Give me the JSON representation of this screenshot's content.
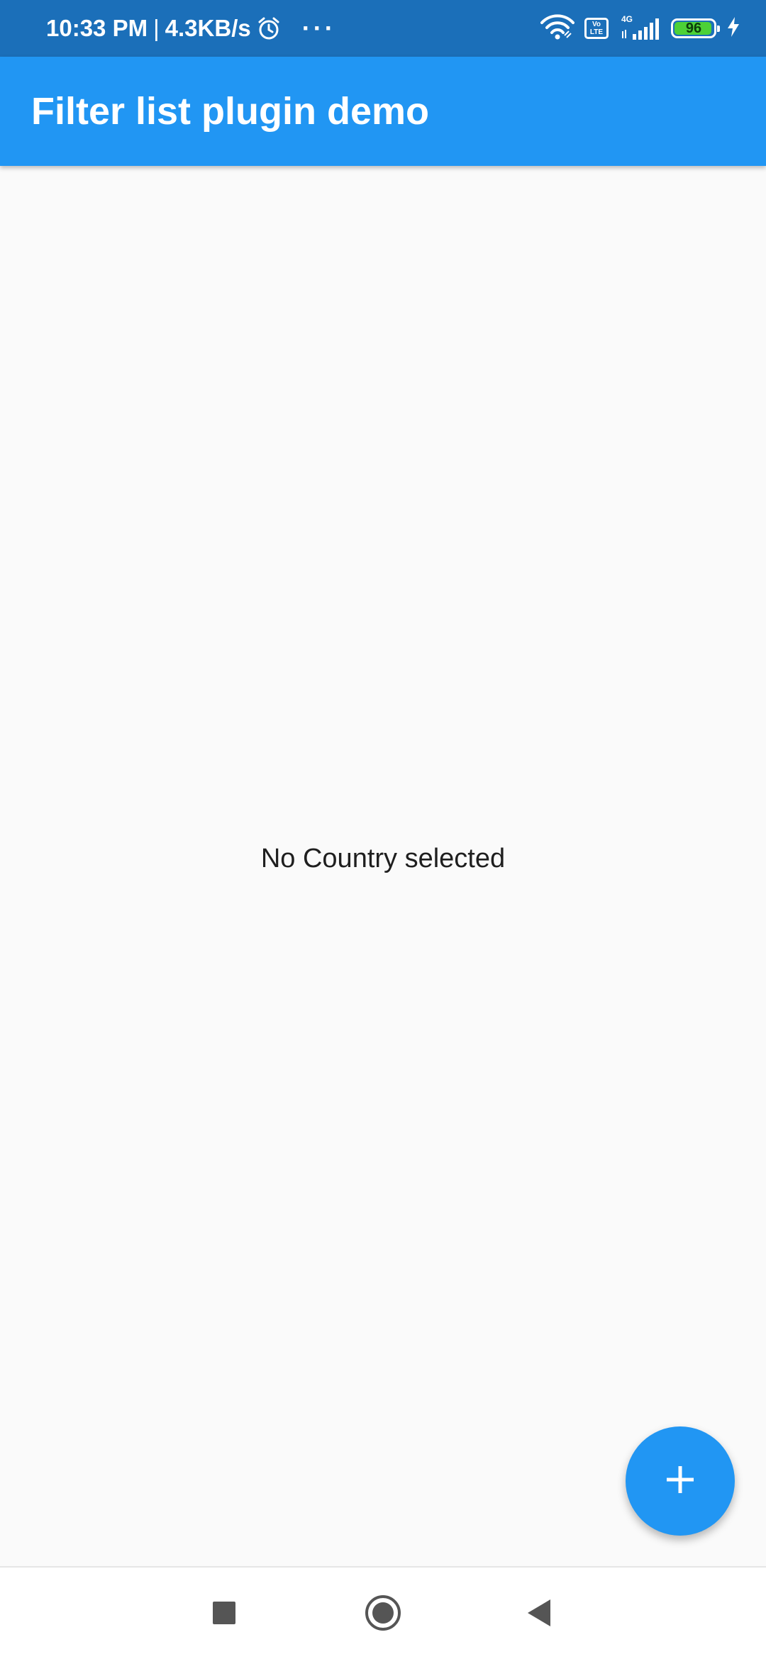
{
  "status_bar": {
    "time": "10:33 PM",
    "separator": "|",
    "net_speed": "4.3KB/s",
    "alarm_icon": "alarm-clock-icon",
    "more_indicator": "···",
    "wifi_icon": "wifi-icon",
    "volte_top": "Vo",
    "volte_bottom": "LTE",
    "network_type": "4G",
    "signal_icon": "cellular-signal-icon",
    "battery_level": "96",
    "battery_fraction": 0.96,
    "charging_icon": "charging-bolt-icon"
  },
  "app_bar": {
    "title": "Filter list plugin demo"
  },
  "main": {
    "empty_message": "No Country selected"
  },
  "fab": {
    "icon": "plus-icon"
  },
  "nav_bar": {
    "recents_icon": "square-recents-icon",
    "home_icon": "circle-home-icon",
    "back_icon": "triangle-back-icon"
  },
  "colors": {
    "status_bar": "#1b6fb9",
    "primary": "#2196f3",
    "background": "#fafafa",
    "battery_fill": "#4cd137"
  }
}
